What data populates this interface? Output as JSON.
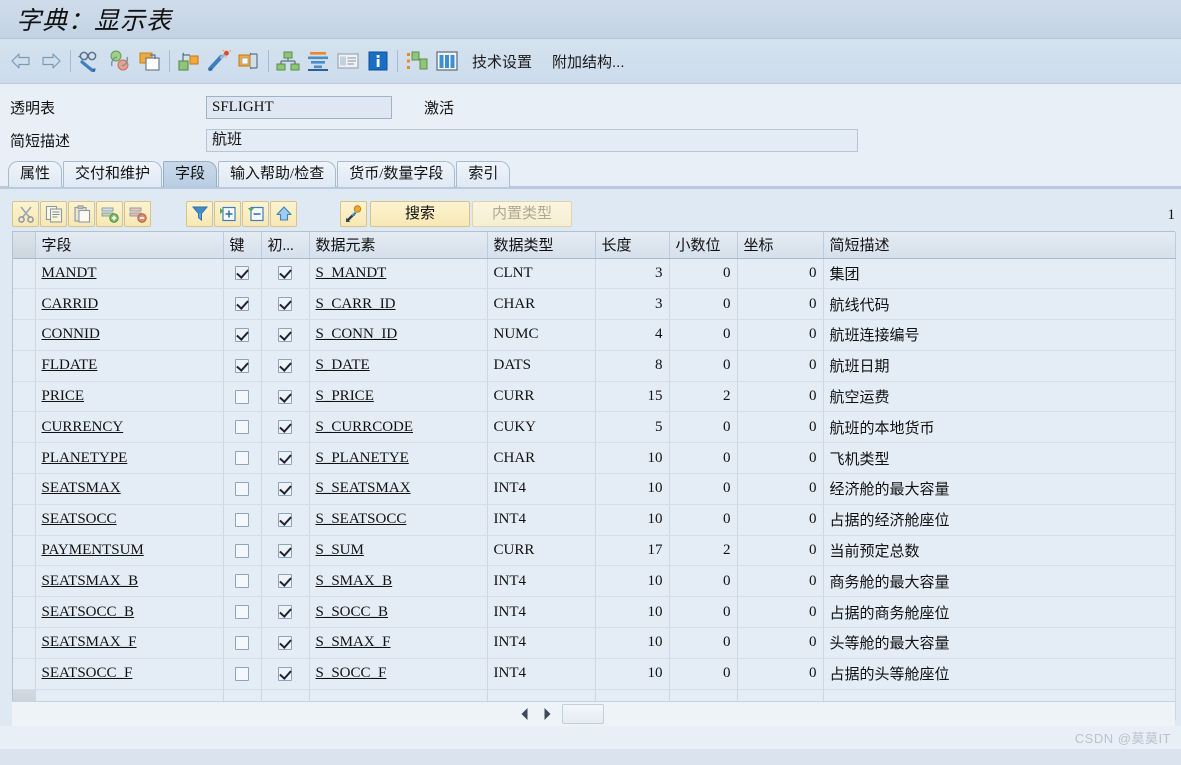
{
  "window": {
    "title": "字典：显示表"
  },
  "toolbar": {
    "icons": [
      {
        "name": "back-arrow-icon",
        "label": "返回"
      },
      {
        "name": "forward-arrow-icon",
        "label": "前进"
      },
      {
        "name": "display-change-icon",
        "label": "显示/修改"
      },
      {
        "name": "check-object-icon",
        "label": "检查"
      },
      {
        "name": "copy-object-icon",
        "label": "复制"
      },
      {
        "name": "where-used-icon",
        "label": "使用位置"
      },
      {
        "name": "activate-icon",
        "label": "激活"
      },
      {
        "name": "transport-icon",
        "label": "传输"
      },
      {
        "name": "hierarchy-icon",
        "label": "层次"
      },
      {
        "name": "indexes-icon",
        "label": "索引"
      },
      {
        "name": "runtime-object-icon",
        "label": "运行时对象"
      },
      {
        "name": "info-icon",
        "label": "信息"
      },
      {
        "name": "append-structure-icon",
        "label": "附加结构"
      },
      {
        "name": "table-contents-icon",
        "label": "表内容"
      }
    ],
    "tech_settings_label": "技术设置",
    "append_structure_label": "附加结构..."
  },
  "header_fields": {
    "table_type_label": "透明表",
    "table_name_value": "SFLIGHT",
    "status_label": "激活",
    "short_desc_label": "简短描述",
    "short_desc_value": "航班"
  },
  "tabs": [
    {
      "label": "属性",
      "active": false
    },
    {
      "label": "交付和维护",
      "active": false
    },
    {
      "label": "字段",
      "active": true
    },
    {
      "label": "输入帮助/检查",
      "active": false
    },
    {
      "label": "货币/数量字段",
      "active": false
    },
    {
      "label": "索引",
      "active": false
    }
  ],
  "subtoolbar": {
    "buttons": [
      {
        "name": "cut-button",
        "icon": "scissors-icon"
      },
      {
        "name": "copy-button",
        "icon": "copy-icon"
      },
      {
        "name": "paste-button",
        "icon": "paste-icon"
      },
      {
        "name": "insert-row-button",
        "icon": "insert-row-icon"
      },
      {
        "name": "delete-row-button",
        "icon": "delete-row-icon"
      },
      {
        "name": "filter-button",
        "icon": "filter-icon"
      },
      {
        "name": "expand-button",
        "icon": "expand-plus-icon"
      },
      {
        "name": "collapse-button",
        "icon": "collapse-minus-icon"
      },
      {
        "name": "predefined-button",
        "icon": "up-triangle-icon"
      },
      {
        "name": "srch-help-button",
        "icon": "key-arrow-icon"
      }
    ],
    "search_label": "搜索",
    "builtin_type_label": "内置类型",
    "builtin_type_disabled": true,
    "row_counter": "1"
  },
  "grid": {
    "columns": [
      {
        "key": "sel",
        "label": ""
      },
      {
        "key": "field",
        "label": "字段"
      },
      {
        "key": "key",
        "label": "键"
      },
      {
        "key": "init",
        "label": "初..."
      },
      {
        "key": "de",
        "label": "数据元素"
      },
      {
        "key": "dt",
        "label": "数据类型"
      },
      {
        "key": "len",
        "label": "长度"
      },
      {
        "key": "dec",
        "label": "小数位"
      },
      {
        "key": "coord",
        "label": "坐标"
      },
      {
        "key": "desc",
        "label": "简短描述"
      }
    ],
    "rows": [
      {
        "field": "MANDT",
        "key": true,
        "init": true,
        "de": "S_MANDT",
        "dt": "CLNT",
        "len": "3",
        "dec": "0",
        "coord": "0",
        "desc": "集团"
      },
      {
        "field": "CARRID",
        "key": true,
        "init": true,
        "de": "S_CARR_ID",
        "dt": "CHAR",
        "len": "3",
        "dec": "0",
        "coord": "0",
        "desc": "航线代码"
      },
      {
        "field": "CONNID",
        "key": true,
        "init": true,
        "de": "S_CONN_ID",
        "dt": "NUMC",
        "len": "4",
        "dec": "0",
        "coord": "0",
        "desc": "航班连接编号"
      },
      {
        "field": "FLDATE",
        "key": true,
        "init": true,
        "de": "S_DATE",
        "dt": "DATS",
        "len": "8",
        "dec": "0",
        "coord": "0",
        "desc": "航班日期"
      },
      {
        "field": "PRICE",
        "key": false,
        "init": true,
        "de": "S_PRICE",
        "dt": "CURR",
        "len": "15",
        "dec": "2",
        "coord": "0",
        "desc": "航空运费"
      },
      {
        "field": "CURRENCY",
        "key": false,
        "init": true,
        "de": "S_CURRCODE",
        "dt": "CUKY",
        "len": "5",
        "dec": "0",
        "coord": "0",
        "desc": "航班的本地货币"
      },
      {
        "field": "PLANETYPE",
        "key": false,
        "init": true,
        "de": "S_PLANETYE",
        "dt": "CHAR",
        "len": "10",
        "dec": "0",
        "coord": "0",
        "desc": "飞机类型"
      },
      {
        "field": "SEATSMAX",
        "key": false,
        "init": true,
        "de": "S_SEATSMAX",
        "dt": "INT4",
        "len": "10",
        "dec": "0",
        "coord": "0",
        "desc": "经济舱的最大容量"
      },
      {
        "field": "SEATSOCC",
        "key": false,
        "init": true,
        "de": "S_SEATSOCC",
        "dt": "INT4",
        "len": "10",
        "dec": "0",
        "coord": "0",
        "desc": "占据的经济舱座位"
      },
      {
        "field": "PAYMENTSUM",
        "key": false,
        "init": true,
        "de": "S_SUM",
        "dt": "CURR",
        "len": "17",
        "dec": "2",
        "coord": "0",
        "desc": "当前预定总数"
      },
      {
        "field": "SEATSMAX_B",
        "key": false,
        "init": true,
        "de": "S_SMAX_B",
        "dt": "INT4",
        "len": "10",
        "dec": "0",
        "coord": "0",
        "desc": "商务舱的最大容量"
      },
      {
        "field": "SEATSOCC_B",
        "key": false,
        "init": true,
        "de": "S_SOCC_B",
        "dt": "INT4",
        "len": "10",
        "dec": "0",
        "coord": "0",
        "desc": "占据的商务舱座位"
      },
      {
        "field": "SEATSMAX_F",
        "key": false,
        "init": true,
        "de": "S_SMAX_F",
        "dt": "INT4",
        "len": "10",
        "dec": "0",
        "coord": "0",
        "desc": "头等舱的最大容量"
      },
      {
        "field": "SEATSOCC_F",
        "key": false,
        "init": true,
        "de": "S_SOCC_F",
        "dt": "INT4",
        "len": "10",
        "dec": "0",
        "coord": "0",
        "desc": "占据的头等舱座位"
      },
      {
        "field": "",
        "key": null,
        "init": null,
        "de": "",
        "dt": "",
        "len": "",
        "dec": "",
        "coord": "",
        "desc": ""
      }
    ]
  },
  "scrollbar": {
    "left_arrow": "left-arrow-icon",
    "right_arrow": "right-arrow-icon"
  },
  "watermark": "CSDN @莫莫IT",
  "colors": {
    "window_bg": "#e8eff7",
    "title_bar": "#c8d8e8",
    "tab_active": "#bfd2e6",
    "button_yellow": "#f7e8b4",
    "grid_row": "#e4edf6",
    "selector_gray": "#c8d0d8"
  }
}
